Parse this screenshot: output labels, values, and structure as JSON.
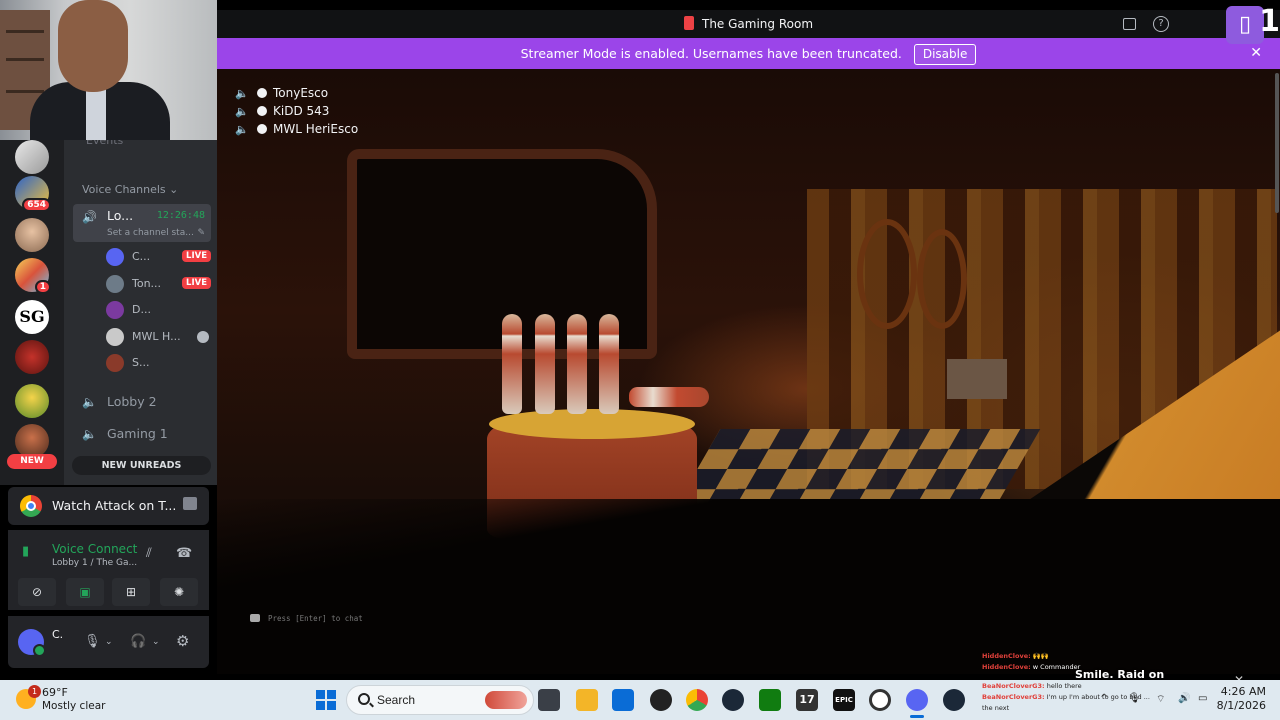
{
  "window": {
    "title": "The Gaming Room",
    "twitch_count": "1"
  },
  "banner": {
    "message": "Streamer Mode is enabled. Usernames have been truncated.",
    "disable_label": "Disable",
    "close_glyph": "✕"
  },
  "servers": [
    {
      "name": "server-sketch",
      "badge": ""
    },
    {
      "name": "server-blue",
      "badge": "654"
    },
    {
      "name": "server-face",
      "badge": ""
    },
    {
      "name": "server-anime",
      "badge": "1"
    },
    {
      "name": "server-sg",
      "label": "SG",
      "badge": ""
    },
    {
      "name": "server-red",
      "badge": ""
    },
    {
      "name": "server-cartoon",
      "badge": ""
    },
    {
      "name": "server-portrait",
      "badge": ""
    }
  ],
  "new_pill": "NEW",
  "channels": {
    "events_label": "Events",
    "category": "Voice Channels",
    "active_channel": {
      "name": "Lo...",
      "timer": "12:26:48",
      "status": "Set a channel sta..."
    },
    "users": [
      {
        "name": "C...",
        "live": "LIVE"
      },
      {
        "name": "Ton...",
        "live": "LIVE"
      },
      {
        "name": "D...",
        "live": ""
      },
      {
        "name": "MWL H...",
        "live": ""
      },
      {
        "name": "S...",
        "live": ""
      }
    ],
    "other_channels": [
      {
        "name": "Lobby 2"
      },
      {
        "name": "Gaming 1"
      }
    ],
    "new_unreads": "NEW UNREADS"
  },
  "activity": {
    "label": "Watch Attack on T..."
  },
  "voice": {
    "status": "Voice Connect",
    "location": "Lobby 1 / The Ga..."
  },
  "userbar": {
    "name": "C."
  },
  "game": {
    "players": [
      "TonyEsco",
      "KiDD 543",
      "MWL HeriEsco"
    ],
    "chat_hint": "Press [Enter] to chat",
    "twitch_chat": [
      {
        "name": "HiddenClove:",
        "msg": " 🙌🙌"
      },
      {
        "name": "HiddenClove:",
        "msg": " w Commander"
      },
      {
        "name": "BeaNorCloverG3:",
        "msg": " hello there"
      },
      {
        "name": "BeaNorCloverG3:",
        "msg": " I'm up I'm about to go to bed ..."
      },
      {
        "name": "",
        "msg": "the next"
      }
    ],
    "streamer_tag": "Smile. Raid on"
  },
  "taskbar": {
    "weather_badge": "1",
    "temperature": "69°F",
    "condition": "Mostly clear",
    "search_placeholder": "Search",
    "time": "4:26 AM",
    "date": "8/1/2026",
    "apps": [
      {
        "name": "file-explorer",
        "label": ""
      },
      {
        "name": "file-folder",
        "label": ""
      },
      {
        "name": "store",
        "label": ""
      },
      {
        "name": "obs",
        "label": ""
      },
      {
        "name": "chrome",
        "label": ""
      },
      {
        "name": "steam",
        "label": ""
      },
      {
        "name": "xbox",
        "label": ""
      },
      {
        "name": "seventeen-app",
        "label": "17"
      },
      {
        "name": "epic-games",
        "label": "EPIC"
      },
      {
        "name": "ring-app",
        "label": ""
      },
      {
        "name": "discord",
        "label": ""
      },
      {
        "name": "steam-2",
        "label": ""
      }
    ]
  },
  "colors": {
    "discord_bg": "#2b2d31",
    "streamer_banner": "#9b45e9",
    "live_red": "#f23f43",
    "voice_green": "#23a55a",
    "twitch_purple": "#8e5bde"
  }
}
